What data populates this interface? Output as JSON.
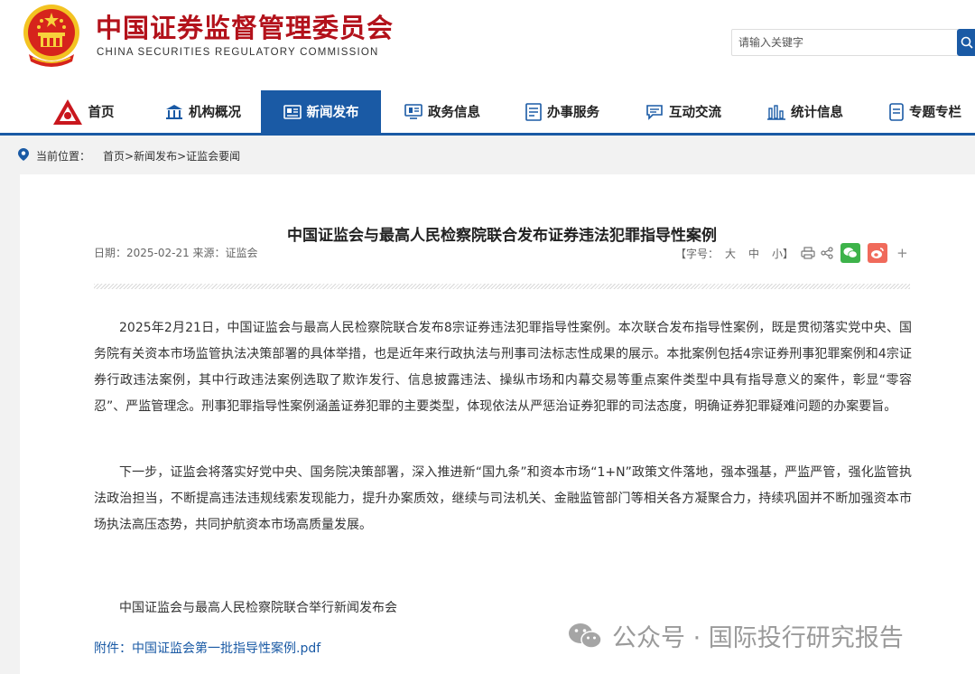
{
  "header": {
    "title": "中国证券监督管理委员会",
    "subtitle": "CHINA SECURITIES REGULATORY COMMISSION",
    "search_placeholder": "请输入关键字",
    "emblem_icon": "national-emblem-icon"
  },
  "nav": {
    "items": [
      {
        "label": "首页",
        "icon": "home-icon"
      },
      {
        "label": "机构概况",
        "icon": "building-icon"
      },
      {
        "label": "新闻发布",
        "icon": "news-icon",
        "active": true
      },
      {
        "label": "政务信息",
        "icon": "monitor-icon"
      },
      {
        "label": "办事服务",
        "icon": "list-icon"
      },
      {
        "label": "互动交流",
        "icon": "chat-icon"
      },
      {
        "label": "统计信息",
        "icon": "bar-chart-icon"
      },
      {
        "label": "专题专栏",
        "icon": "document-icon"
      }
    ],
    "accent": "#1a5aa5"
  },
  "breadcrumb": {
    "label": "当前位置：",
    "path": "首页>新闻发布>证监会要闻"
  },
  "article": {
    "title": "中国证监会与最高人民检察院联合发布证券违法犯罪指导性案例",
    "meta": "日期：2025-02-21 来源：证监会",
    "font_label_open": "【字号：",
    "size_large": "大",
    "size_medium": "中",
    "size_small": "小】",
    "paragraphs": [
      "2025年2月21日，中国证监会与最高人民检察院联合发布8宗证券违法犯罪指导性案例。本次联合发布指导性案例，既是贯彻落实党中央、国务院有关资本市场监管执法决策部署的具体举措，也是近年来行政执法与刑事司法标志性成果的展示。本批案例包括4宗证券刑事犯罪案例和4宗证券行政违法案例，其中行政违法案例选取了欺诈发行、信息披露违法、操纵市场和内幕交易等重点案件类型中具有指导意义的案件，彰显“零容忍”、严监管理念。刑事犯罪指导性案例涵盖证券犯罪的主要类型，体现依法从严惩治证券犯罪的司法态度，明确证券犯罪疑难问题的办案要旨。",
      "下一步，证监会将落实好党中央、国务院决策部署，深入推进新“国九条”和资本市场“1+N”政策文件落地，强本强基，严监严管，强化监管执法政治担当，不断提高违法违规线索发现能力，提升办案质效，继续与司法机关、金融监管部门等相关各方凝聚合力，持续巩固并不断加强资本市场执法高压态势，共同护航资本市场高质量发展。"
    ],
    "signature": "中国证监会与最高人民检察院联合举行新闻发布会",
    "attachment": "附件：中国证监会第一批指导性案例.pdf"
  },
  "watermark": {
    "text": "公众号 · 国际投行研究报告",
    "icon": "wechat-icon"
  }
}
